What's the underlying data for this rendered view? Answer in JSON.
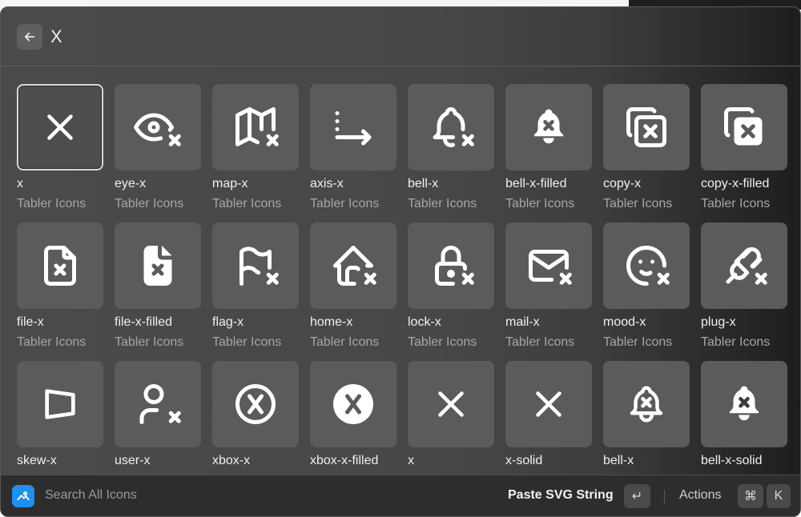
{
  "search": {
    "query": "X",
    "back_icon": "arrow-left-icon"
  },
  "results": [
    {
      "name": "x",
      "source": "Tabler Icons",
      "icon": "x"
    },
    {
      "name": "eye-x",
      "source": "Tabler Icons",
      "icon": "eye-x"
    },
    {
      "name": "map-x",
      "source": "Tabler Icons",
      "icon": "map-x"
    },
    {
      "name": "axis-x",
      "source": "Tabler Icons",
      "icon": "axis-x"
    },
    {
      "name": "bell-x",
      "source": "Tabler Icons",
      "icon": "bell-x"
    },
    {
      "name": "bell-x-filled",
      "source": "Tabler Icons",
      "icon": "bell-x-filled"
    },
    {
      "name": "copy-x",
      "source": "Tabler Icons",
      "icon": "copy-x"
    },
    {
      "name": "copy-x-filled",
      "source": "Tabler Icons",
      "icon": "copy-x-filled"
    },
    {
      "name": "file-x",
      "source": "Tabler Icons",
      "icon": "file-x"
    },
    {
      "name": "file-x-filled",
      "source": "Tabler Icons",
      "icon": "file-x-filled"
    },
    {
      "name": "flag-x",
      "source": "Tabler Icons",
      "icon": "flag-x"
    },
    {
      "name": "home-x",
      "source": "Tabler Icons",
      "icon": "home-x"
    },
    {
      "name": "lock-x",
      "source": "Tabler Icons",
      "icon": "lock-x"
    },
    {
      "name": "mail-x",
      "source": "Tabler Icons",
      "icon": "mail-x"
    },
    {
      "name": "mood-x",
      "source": "Tabler Icons",
      "icon": "mood-x"
    },
    {
      "name": "plug-x",
      "source": "Tabler Icons",
      "icon": "plug-x"
    },
    {
      "name": "skew-x",
      "source": "",
      "icon": "skew-x"
    },
    {
      "name": "user-x",
      "source": "",
      "icon": "user-x"
    },
    {
      "name": "xbox-x",
      "source": "",
      "icon": "xbox-x"
    },
    {
      "name": "xbox-x-filled",
      "source": "",
      "icon": "xbox-x-filled"
    },
    {
      "name": "x",
      "source": "",
      "icon": "x"
    },
    {
      "name": "x-solid",
      "source": "",
      "icon": "x"
    },
    {
      "name": "bell-x",
      "source": "",
      "icon": "bell-x-outline"
    },
    {
      "name": "bell-x-solid",
      "source": "",
      "icon": "bell-x-solid"
    }
  ],
  "selected_index": 0,
  "footer": {
    "app_icon": "app-logo-icon",
    "search_label": "Search All Icons",
    "primary_action": "Paste SVG String",
    "enter_key": "↵",
    "actions_label": "Actions",
    "cmd_key": "⌘",
    "k_key": "K"
  }
}
